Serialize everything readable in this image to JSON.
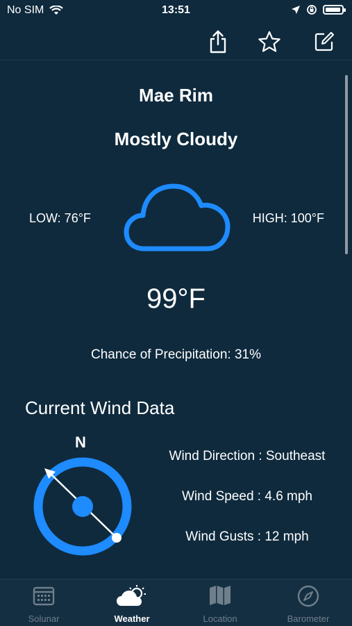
{
  "status": {
    "carrier": "No SIM",
    "time": "13:51"
  },
  "toolbar": {
    "share_icon": "share-icon",
    "favorite_icon": "star-icon",
    "edit_icon": "edit-icon"
  },
  "weather": {
    "location": "Mae Rim",
    "condition": "Mostly Cloudy",
    "low": "LOW: 76°F",
    "high": "HIGH: 100°F",
    "temperature": "99°F",
    "precipitation": "Chance of Precipitation: 31%",
    "icon": "cloud-icon",
    "accent_color": "#1e8bff"
  },
  "wind": {
    "title": "Current Wind Data",
    "compass_north": "N",
    "direction": "Wind Direction : Southeast",
    "speed": "Wind Speed : 4.6 mph",
    "gusts": "Wind Gusts : 12 mph"
  },
  "tabs": [
    {
      "label": "Solunar",
      "icon": "calendar-icon",
      "active": false
    },
    {
      "label": "Weather",
      "icon": "partly-cloudy-icon",
      "active": true
    },
    {
      "label": "Location",
      "icon": "map-icon",
      "active": false
    },
    {
      "label": "Barometer",
      "icon": "compass-icon",
      "active": false
    }
  ]
}
